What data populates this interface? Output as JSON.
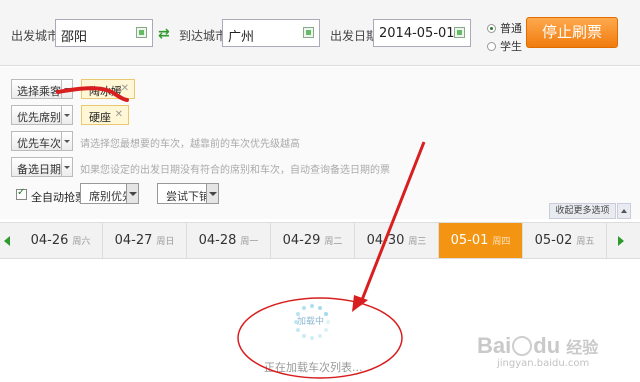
{
  "search": {
    "from_label": "出发城市",
    "from_value": "邵阳",
    "to_label": "到达城市",
    "to_value": "广州",
    "date_label": "出发日期",
    "date_value": "2014-05-01",
    "type_normal": "普通",
    "type_student": "学生",
    "selected_type": "普通",
    "stop_button": "停止刷票"
  },
  "options": {
    "select_passenger": "选择乘客",
    "passenger_tag": "陶冰媛",
    "seat_priority": "优先席别",
    "seat_tag": "硬座",
    "train_priority": "优先车次",
    "train_hint": "请选择您最想要的车次，越靠前的车次优先级越高",
    "backup_date": "备选日期",
    "backup_hint": "如果您设定的出发日期没有符合的席别和车次，自动查询备选日期的票",
    "auto_grab_label": "全自动抢票",
    "auto_grab_checked": true,
    "seat_first": "席别优先",
    "try_sleeper": "尝试下铺",
    "collapse_more": "收起更多选项"
  },
  "dates": [
    {
      "date": "04-26",
      "weekday": "周六",
      "active": false
    },
    {
      "date": "04-27",
      "weekday": "周日",
      "active": false
    },
    {
      "date": "04-28",
      "weekday": "周一",
      "active": false
    },
    {
      "date": "04-29",
      "weekday": "周二",
      "active": false
    },
    {
      "date": "04-30",
      "weekday": "周三",
      "active": false
    },
    {
      "date": "05-01",
      "weekday": "周四",
      "active": true
    },
    {
      "date": "05-02",
      "weekday": "周五",
      "active": false
    }
  ],
  "loading": {
    "spinner_text": "加载中",
    "status_text": "正在加载车次列表..."
  },
  "watermark": {
    "logo": "Bai du 经验",
    "url": "jingyan.baidu.com"
  },
  "colors": {
    "accent_orange": "#f39512",
    "stop_button": "#f07c0f",
    "annotation_red": "#d81e1e",
    "nav_green": "#2e9a2e"
  }
}
